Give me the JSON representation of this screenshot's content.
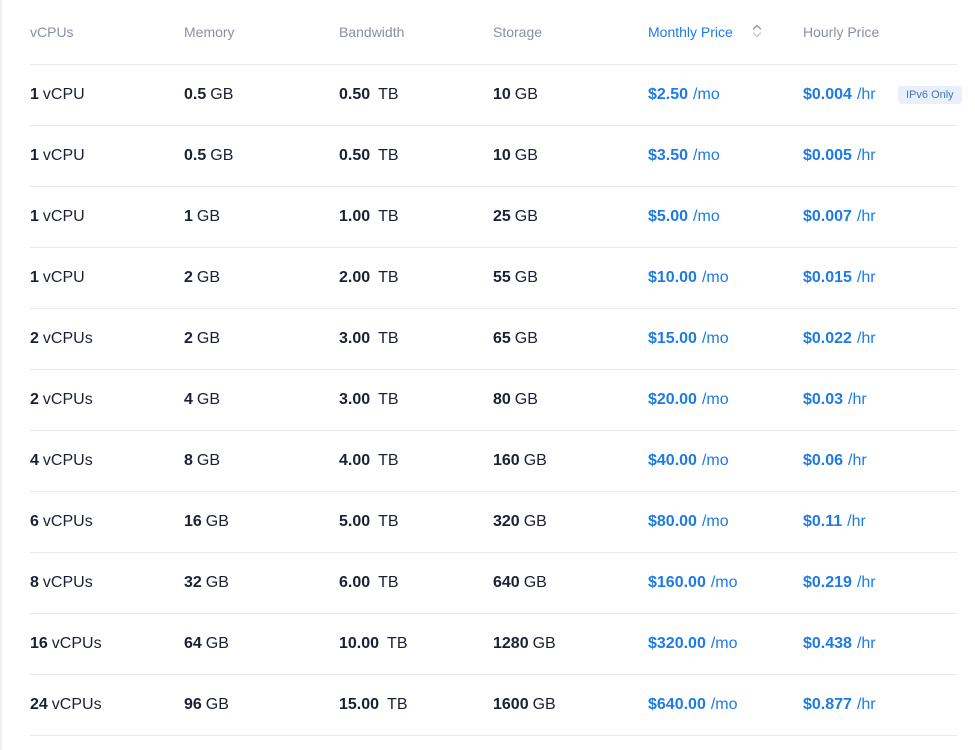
{
  "columns": {
    "vcpus": "vCPUs",
    "memory": "Memory",
    "bandwidth": "Bandwidth",
    "storage": "Storage",
    "monthly_price": "Monthly Price",
    "hourly_price": "Hourly Price"
  },
  "sort": {
    "column": "Monthly Price",
    "icon": "sort-icon"
  },
  "colors": {
    "accent": "#1e7be6",
    "header_text": "#8a8fa3",
    "body_text": "#1b2033",
    "divider": "#e7e9ee",
    "badge_bg": "#e8f0fb",
    "badge_text": "#4a74b8"
  },
  "plans": [
    {
      "vcpu_count": "1",
      "vcpu_unit": "vCPU",
      "memory": "0.5",
      "memory_unit": "GB",
      "bandwidth": "0.50",
      "bandwidth_unit": "TB",
      "storage": "10",
      "storage_unit": "GB",
      "monthly": "$2.50",
      "monthly_unit": "/mo",
      "hourly": "$0.004",
      "hourly_unit": "/hr",
      "badge": "IPv6 Only"
    },
    {
      "vcpu_count": "1",
      "vcpu_unit": "vCPU",
      "memory": "0.5",
      "memory_unit": "GB",
      "bandwidth": "0.50",
      "bandwidth_unit": "TB",
      "storage": "10",
      "storage_unit": "GB",
      "monthly": "$3.50",
      "monthly_unit": "/mo",
      "hourly": "$0.005",
      "hourly_unit": "/hr",
      "badge": ""
    },
    {
      "vcpu_count": "1",
      "vcpu_unit": "vCPU",
      "memory": "1",
      "memory_unit": "GB",
      "bandwidth": "1.00",
      "bandwidth_unit": "TB",
      "storage": "25",
      "storage_unit": "GB",
      "monthly": "$5.00",
      "monthly_unit": "/mo",
      "hourly": "$0.007",
      "hourly_unit": "/hr",
      "badge": ""
    },
    {
      "vcpu_count": "1",
      "vcpu_unit": "vCPU",
      "memory": "2",
      "memory_unit": "GB",
      "bandwidth": "2.00",
      "bandwidth_unit": "TB",
      "storage": "55",
      "storage_unit": "GB",
      "monthly": "$10.00",
      "monthly_unit": "/mo",
      "hourly": "$0.015",
      "hourly_unit": "/hr",
      "badge": ""
    },
    {
      "vcpu_count": "2",
      "vcpu_unit": "vCPUs",
      "memory": "2",
      "memory_unit": "GB",
      "bandwidth": "3.00",
      "bandwidth_unit": "TB",
      "storage": "65",
      "storage_unit": "GB",
      "monthly": "$15.00",
      "monthly_unit": "/mo",
      "hourly": "$0.022",
      "hourly_unit": "/hr",
      "badge": ""
    },
    {
      "vcpu_count": "2",
      "vcpu_unit": "vCPUs",
      "memory": "4",
      "memory_unit": "GB",
      "bandwidth": "3.00",
      "bandwidth_unit": "TB",
      "storage": "80",
      "storage_unit": "GB",
      "monthly": "$20.00",
      "monthly_unit": "/mo",
      "hourly": "$0.03",
      "hourly_unit": "/hr",
      "badge": ""
    },
    {
      "vcpu_count": "4",
      "vcpu_unit": "vCPUs",
      "memory": "8",
      "memory_unit": "GB",
      "bandwidth": "4.00",
      "bandwidth_unit": "TB",
      "storage": "160",
      "storage_unit": "GB",
      "monthly": "$40.00",
      "monthly_unit": "/mo",
      "hourly": "$0.06",
      "hourly_unit": "/hr",
      "badge": ""
    },
    {
      "vcpu_count": "6",
      "vcpu_unit": "vCPUs",
      "memory": "16",
      "memory_unit": "GB",
      "bandwidth": "5.00",
      "bandwidth_unit": "TB",
      "storage": "320",
      "storage_unit": "GB",
      "monthly": "$80.00",
      "monthly_unit": "/mo",
      "hourly": "$0.11",
      "hourly_unit": "/hr",
      "badge": ""
    },
    {
      "vcpu_count": "8",
      "vcpu_unit": "vCPUs",
      "memory": "32",
      "memory_unit": "GB",
      "bandwidth": "6.00",
      "bandwidth_unit": "TB",
      "storage": "640",
      "storage_unit": "GB",
      "monthly": "$160.00",
      "monthly_unit": "/mo",
      "hourly": "$0.219",
      "hourly_unit": "/hr",
      "badge": ""
    },
    {
      "vcpu_count": "16",
      "vcpu_unit": "vCPUs",
      "memory": "64",
      "memory_unit": "GB",
      "bandwidth": "10.00",
      "bandwidth_unit": "TB",
      "storage": "1280",
      "storage_unit": "GB",
      "monthly": "$320.00",
      "monthly_unit": "/mo",
      "hourly": "$0.438",
      "hourly_unit": "/hr",
      "badge": ""
    },
    {
      "vcpu_count": "24",
      "vcpu_unit": "vCPUs",
      "memory": "96",
      "memory_unit": "GB",
      "bandwidth": "15.00",
      "bandwidth_unit": "TB",
      "storage": "1600",
      "storage_unit": "GB",
      "monthly": "$640.00",
      "monthly_unit": "/mo",
      "hourly": "$0.877",
      "hourly_unit": "/hr",
      "badge": ""
    }
  ]
}
